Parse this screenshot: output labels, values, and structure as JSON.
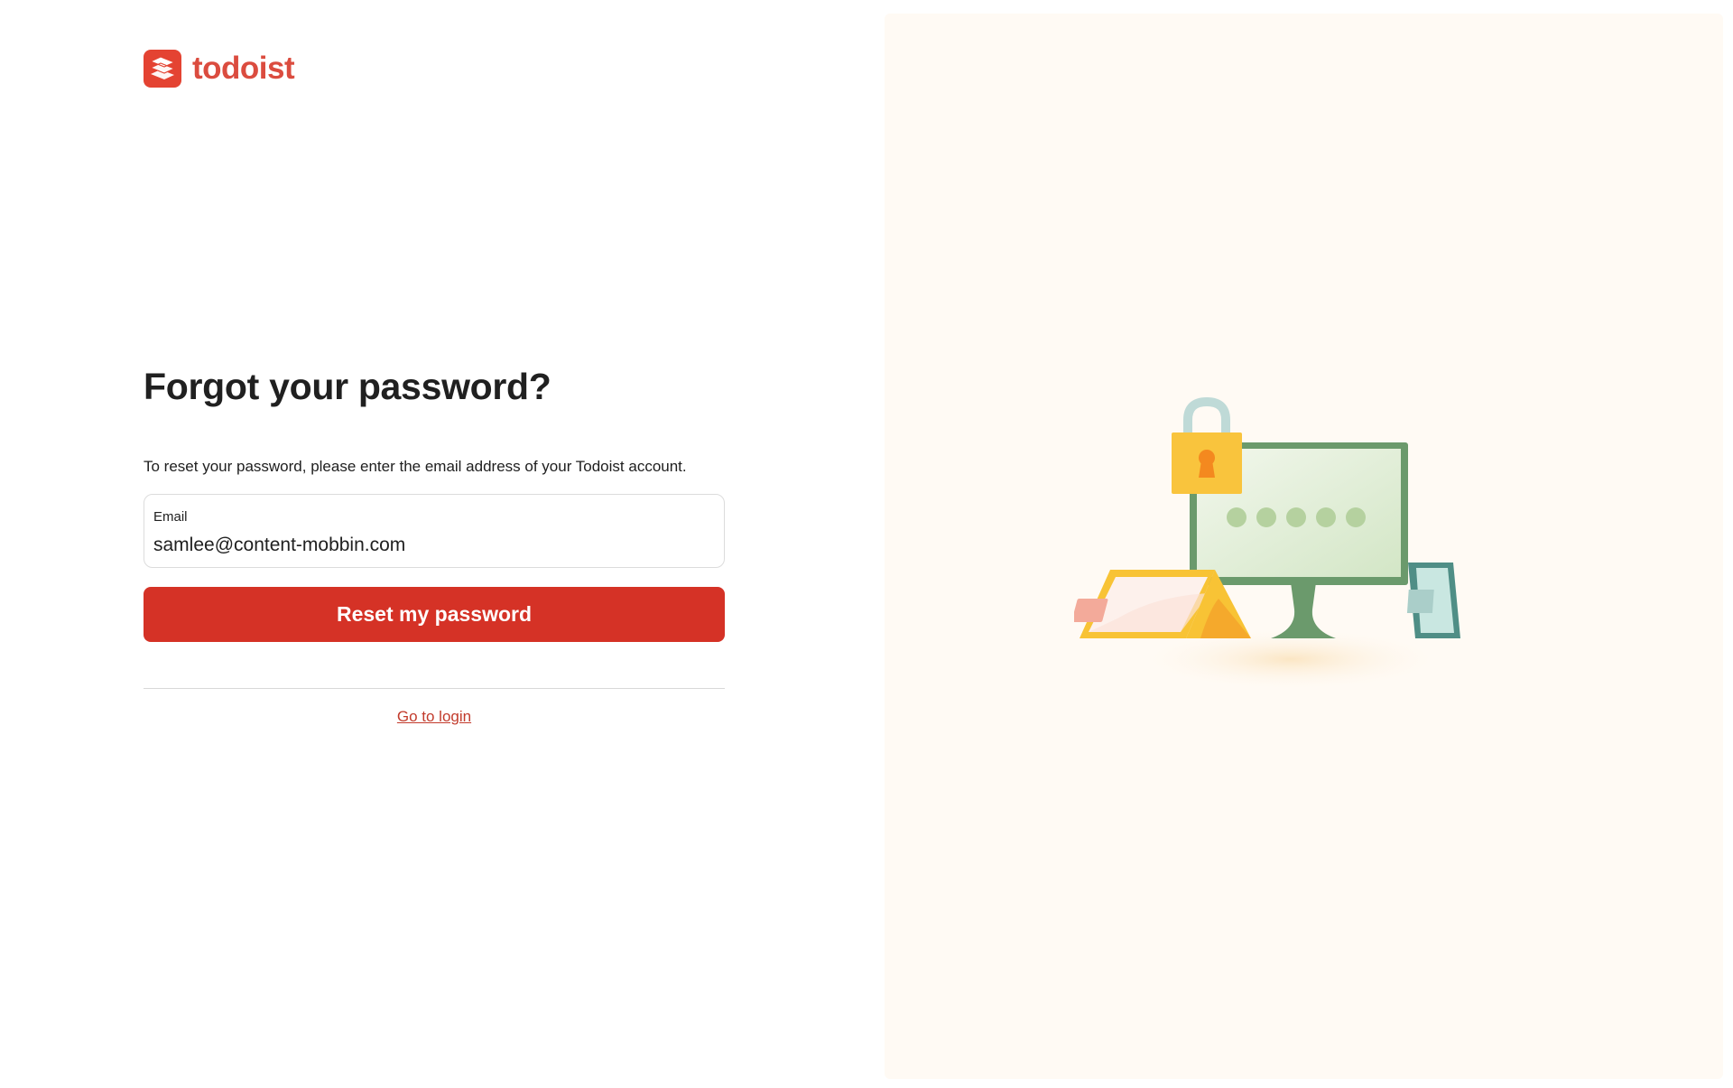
{
  "brand": {
    "name": "todoist",
    "logo_icon": "todoist-logo-icon",
    "color": "#db4c3f"
  },
  "form": {
    "title": "Forgot your password?",
    "description": "To reset your password, please enter the email address of your Todoist account.",
    "email_label": "Email",
    "email_value": "samlee@content-mobbin.com",
    "submit_label": "Reset my password",
    "submit_color": "#d53226",
    "login_link": "Go to login"
  },
  "illustration": {
    "name": "security-illustration",
    "icons": [
      "padlock-icon",
      "monitor-icon",
      "laptop-icon",
      "phone-icon"
    ]
  }
}
